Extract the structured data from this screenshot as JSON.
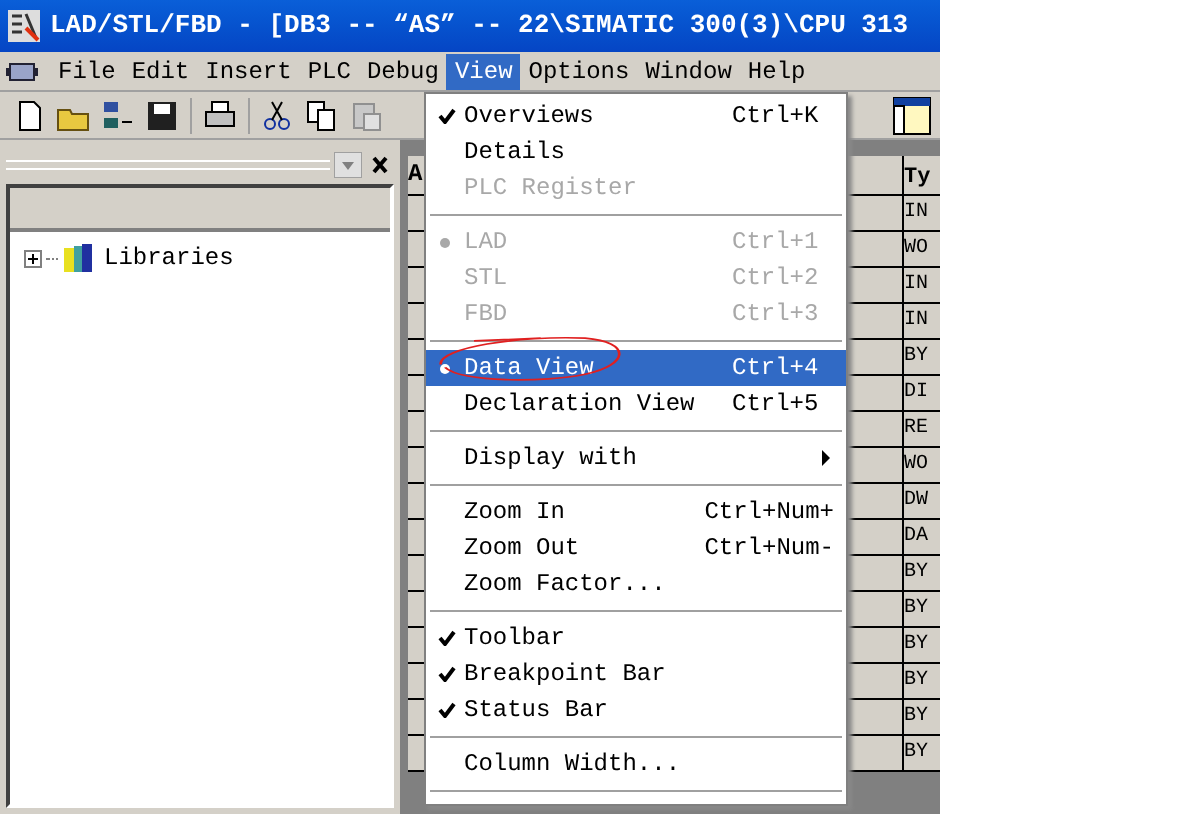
{
  "window": {
    "title": "LAD/STL/FBD  - [DB3 -- “AS” -- 22\\SIMATIC 300(3)\\CPU 313"
  },
  "menu_bar": [
    {
      "label": "File",
      "selected": false
    },
    {
      "label": "Edit",
      "selected": false
    },
    {
      "label": "Insert",
      "selected": false
    },
    {
      "label": "PLC",
      "selected": false
    },
    {
      "label": "Debug",
      "selected": false
    },
    {
      "label": "View",
      "selected": true
    },
    {
      "label": "Options",
      "selected": false
    },
    {
      "label": "Window",
      "selected": false
    },
    {
      "label": "Help",
      "selected": false
    }
  ],
  "view_menu": [
    {
      "kind": "item",
      "label": "Overviews",
      "shortcut": "Ctrl+K",
      "checked": true,
      "radio": false,
      "disabled": false,
      "selected": false
    },
    {
      "kind": "item",
      "label": "Details",
      "checked": false,
      "radio": false,
      "disabled": false,
      "selected": false
    },
    {
      "kind": "item",
      "label": "PLC Register",
      "checked": false,
      "radio": false,
      "disabled": true,
      "selected": false
    },
    {
      "kind": "separator"
    },
    {
      "kind": "item",
      "label": "LAD",
      "shortcut": "Ctrl+1",
      "checked": false,
      "radio": true,
      "disabled": true,
      "selected": false
    },
    {
      "kind": "item",
      "label": "STL",
      "shortcut": "Ctrl+2",
      "checked": false,
      "radio": false,
      "disabled": true,
      "selected": false
    },
    {
      "kind": "item",
      "label": "FBD",
      "shortcut": "Ctrl+3",
      "checked": false,
      "radio": false,
      "disabled": true,
      "selected": false
    },
    {
      "kind": "separator"
    },
    {
      "kind": "item",
      "label": "Data View",
      "shortcut": "Ctrl+4",
      "checked": false,
      "radio": true,
      "disabled": false,
      "selected": true
    },
    {
      "kind": "item",
      "label": "Declaration View",
      "shortcut": "Ctrl+5",
      "checked": false,
      "radio": false,
      "disabled": false,
      "selected": false
    },
    {
      "kind": "separator"
    },
    {
      "kind": "submenu",
      "label": "Display with",
      "checked": false,
      "radio": false,
      "disabled": false,
      "selected": false
    },
    {
      "kind": "separator"
    },
    {
      "kind": "item",
      "label": "Zoom In",
      "shortcut": "Ctrl+Num+",
      "checked": false,
      "radio": false,
      "disabled": false,
      "selected": false
    },
    {
      "kind": "item",
      "label": "Zoom Out",
      "shortcut": "Ctrl+Num-",
      "checked": false,
      "radio": false,
      "disabled": false,
      "selected": false
    },
    {
      "kind": "item",
      "label": "Zoom Factor...",
      "checked": false,
      "radio": false,
      "disabled": false,
      "selected": false
    },
    {
      "kind": "separator"
    },
    {
      "kind": "item",
      "label": "Toolbar",
      "checked": true,
      "radio": false,
      "disabled": false,
      "selected": false
    },
    {
      "kind": "item",
      "label": "Breakpoint Bar",
      "checked": true,
      "radio": false,
      "disabled": false,
      "selected": false
    },
    {
      "kind": "item",
      "label": "Status Bar",
      "checked": true,
      "radio": false,
      "disabled": false,
      "selected": false
    },
    {
      "kind": "separator"
    },
    {
      "kind": "item",
      "label": "Column Width...",
      "checked": false,
      "radio": false,
      "disabled": false,
      "selected": false
    },
    {
      "kind": "separator"
    }
  ],
  "tree": [
    {
      "label": "Libraries",
      "expanded": false
    }
  ],
  "table": {
    "columns": [
      "A",
      "Ty"
    ],
    "rows": [
      "IN",
      "WO",
      "IN",
      "IN",
      "BY",
      "DI",
      "RE",
      "WO",
      "DW",
      "DA",
      "BY",
      "BY",
      "BY",
      "BY",
      "BY",
      "BY"
    ]
  }
}
